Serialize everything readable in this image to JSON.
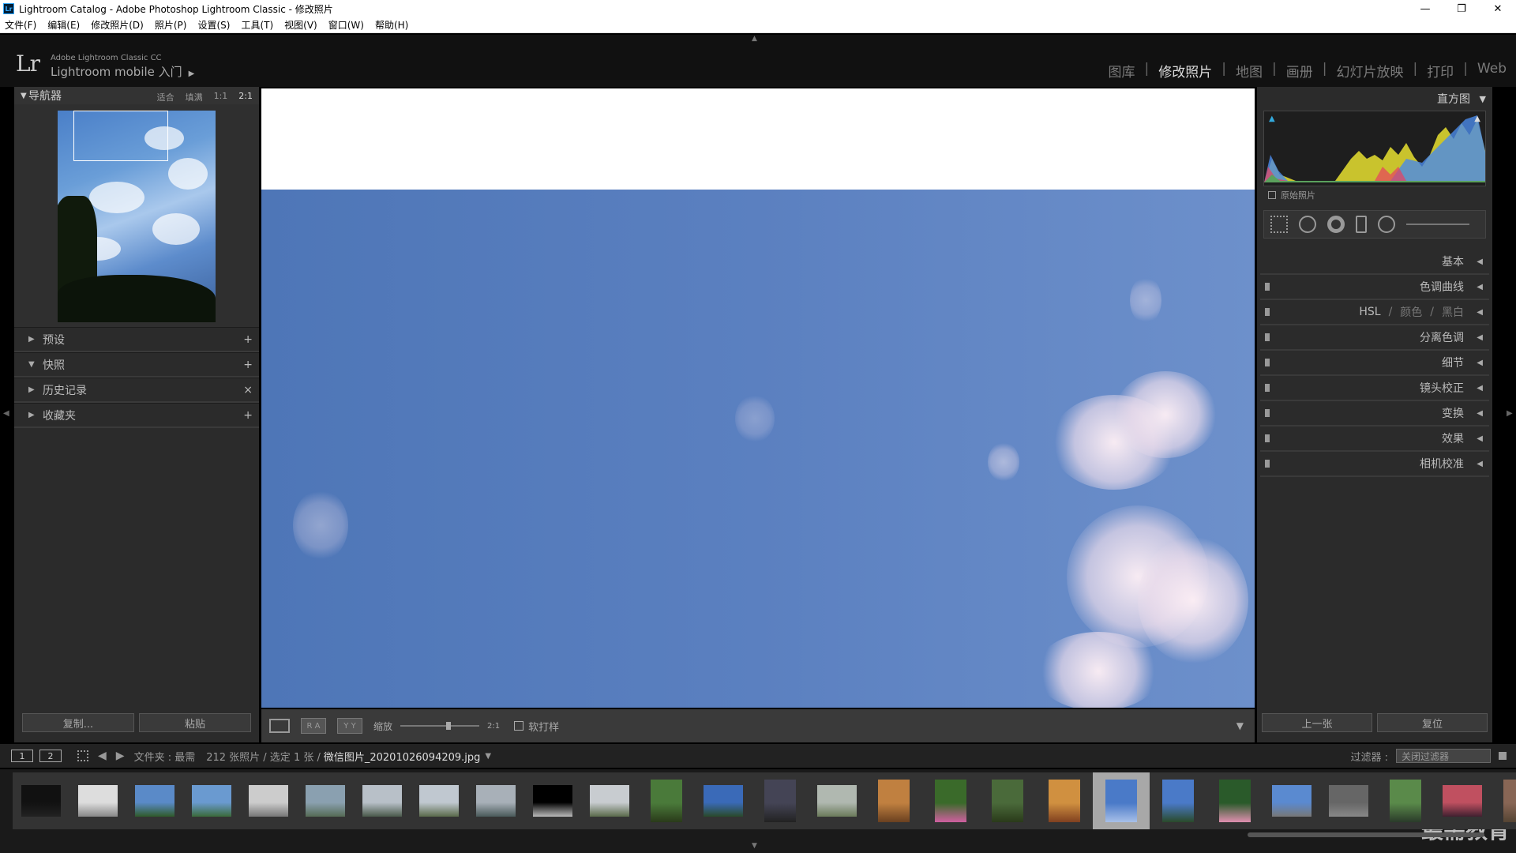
{
  "window": {
    "title": "Lightroom Catalog - Adobe Photoshop Lightroom Classic - 修改照片",
    "badge": "Lr"
  },
  "menu": [
    "文件(F)",
    "编辑(E)",
    "修改照片(D)",
    "照片(P)",
    "设置(S)",
    "工具(T)",
    "视图(V)",
    "窗口(W)",
    "帮助(H)"
  ],
  "identity": {
    "logo": "Lr",
    "small": "Adobe Lightroom Classic CC",
    "big": "Lightroom mobile 入门"
  },
  "modules": [
    {
      "label": "图库",
      "active": false
    },
    {
      "label": "修改照片",
      "active": true
    },
    {
      "label": "地图",
      "active": false
    },
    {
      "label": "画册",
      "active": false
    },
    {
      "label": "幻灯片放映",
      "active": false
    },
    {
      "label": "打印",
      "active": false
    },
    {
      "label": "Web",
      "active": false
    }
  ],
  "navigator": {
    "title": "导航器",
    "zoom": [
      "适合",
      "填满",
      "1:1",
      "2:1"
    ],
    "selected_zoom": "2:1"
  },
  "left_sections": [
    {
      "label": "预设",
      "expanded": false,
      "action": "+"
    },
    {
      "label": "快照",
      "expanded": true,
      "action": "+"
    },
    {
      "label": "历史记录",
      "expanded": false,
      "action": "×"
    },
    {
      "label": "收藏夹",
      "expanded": false,
      "action": "+"
    }
  ],
  "left_buttons": {
    "copy": "复制...",
    "paste": "粘贴"
  },
  "toolbar": {
    "zoom_label": "缩放",
    "zoom_value": "2:1",
    "softproof": "软打样",
    "ra": "R A",
    "yy": "Y Y"
  },
  "histogram": {
    "title": "直方图",
    "original": "原始照片"
  },
  "right_sections": [
    {
      "label": "基本",
      "switch": false
    },
    {
      "label": "色调曲线",
      "switch": true
    },
    {
      "label": "HSL",
      "extra": [
        "颜色",
        "黑白"
      ],
      "switch": true
    },
    {
      "label": "分离色调",
      "switch": true
    },
    {
      "label": "细节",
      "switch": true
    },
    {
      "label": "镜头校正",
      "switch": true
    },
    {
      "label": "变换",
      "switch": true
    },
    {
      "label": "效果",
      "switch": true
    },
    {
      "label": "相机校准",
      "switch": true
    }
  ],
  "right_buttons": {
    "prev": "上一张",
    "reset": "复位"
  },
  "filmstrip_bar": {
    "page1": "1",
    "page2": "2",
    "source": "文件夹 : 最需",
    "count": "212 张照片 / 选定 1 张 /",
    "filename": "微信图片_20201026094209.jpg",
    "filter_label": "过滤器 :",
    "filter_value": "关闭过滤器"
  },
  "thumbs": [
    {
      "c1": "#111",
      "c2": "#222",
      "port": false
    },
    {
      "c1": "#ddd",
      "c2": "#888",
      "port": false
    },
    {
      "c1": "#5a8ac8",
      "c2": "#2f5a2a",
      "port": false
    },
    {
      "c1": "#6a9ad0",
      "c2": "#3a6a3a",
      "port": false
    },
    {
      "c1": "#ccc",
      "c2": "#777",
      "port": false
    },
    {
      "c1": "#8aa0b0",
      "c2": "#556a55",
      "port": false
    },
    {
      "c1": "#b8c0c8",
      "c2": "#4a5a4a",
      "port": false
    },
    {
      "c1": "#c0c8d0",
      "c2": "#5a6a4a",
      "port": false
    },
    {
      "c1": "#a8b0b8",
      "c2": "#4a5a5a",
      "port": false
    },
    {
      "c1": "#000",
      "c2": "#bbb",
      "port": false
    },
    {
      "c1": "#c8ccd0",
      "c2": "#5a6a4a",
      "port": false
    },
    {
      "c1": "#4a7a3a",
      "c2": "#2a3a1a",
      "port": true
    },
    {
      "c1": "#3a6ab8",
      "c2": "#2a4a2a",
      "port": false
    },
    {
      "c1": "#445",
      "c2": "#222",
      "port": true
    },
    {
      "c1": "#b0b8b0",
      "c2": "#6a7a5a",
      "port": false
    },
    {
      "c1": "#c08040",
      "c2": "#6a4020",
      "port": true
    },
    {
      "c1": "#3a6a2a",
      "c2": "#d060a0",
      "port": true
    },
    {
      "c1": "#4a6a3a",
      "c2": "#2a3a1a",
      "port": true
    },
    {
      "c1": "#d09040",
      "c2": "#804020",
      "port": true
    },
    {
      "c1": "#4a7ac8",
      "c2": "#a8c0e8",
      "port": true
    },
    {
      "c1": "#4a7ac8",
      "c2": "#2a4a2a",
      "port": true
    },
    {
      "c1": "#2a5a2a",
      "c2": "#e090b0",
      "port": true
    },
    {
      "c1": "#5a8ad0",
      "c2": "#777",
      "port": false
    },
    {
      "c1": "#666",
      "c2": "#888",
      "port": false
    },
    {
      "c1": "#5a8a4a",
      "c2": "#2a3a2a",
      "port": true
    },
    {
      "c1": "#c05060",
      "c2": "#402030",
      "port": false
    },
    {
      "c1": "#886655",
      "c2": "#554433",
      "port": true
    }
  ],
  "selected_thumb": 19,
  "watermark": "最需教育"
}
